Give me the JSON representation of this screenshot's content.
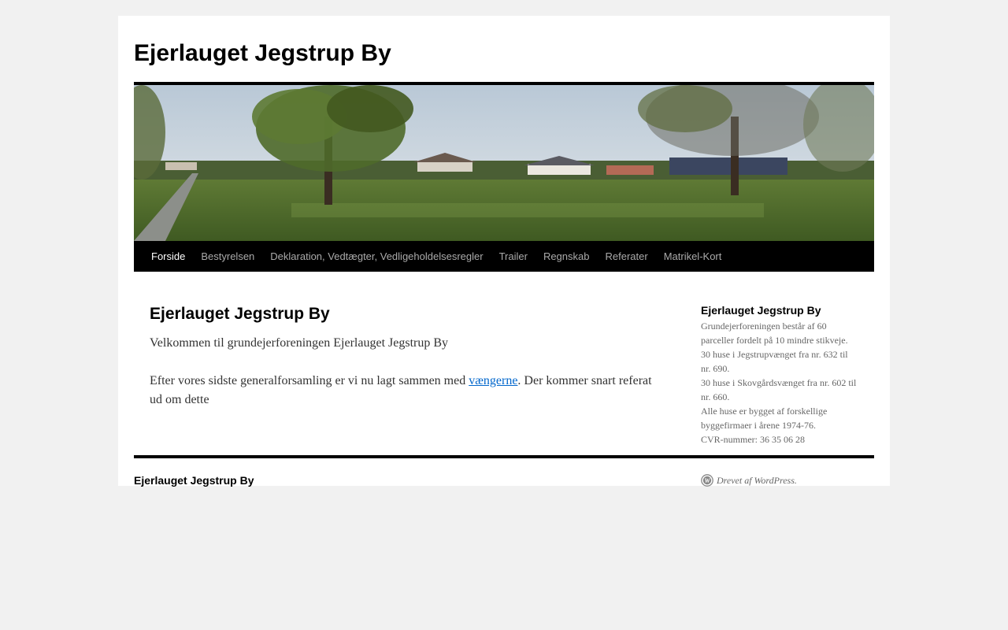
{
  "site": {
    "title": "Ejerlauget Jegstrup By"
  },
  "nav": {
    "items": [
      {
        "label": "Forside"
      },
      {
        "label": "Bestyrelsen"
      },
      {
        "label": "Deklaration, Vedtægter, Vedligeholdelsesregler"
      },
      {
        "label": "Trailer"
      },
      {
        "label": "Regnskab"
      },
      {
        "label": "Referater"
      },
      {
        "label": "Matrikel-Kort"
      }
    ]
  },
  "header_image": {
    "icon": "header-photo"
  },
  "main": {
    "title": "Ejerlauget Jegstrup By",
    "para1": "Velkommen til grundejerforeningen Ejerlauget Jegstrup By",
    "para2_before": "Efter vores sidste generalforsamling er vi nu lagt sammen med ",
    "para2_link": "vængerne",
    "para2_after": ". Der kommer snart referat ud om dette"
  },
  "sidebar": {
    "title": "Ejerlauget Jegstrup By",
    "lines": [
      "Grundejerforeningen består af 60 parceller fordelt på 10 mindre stikveje.",
      "30 huse i Jegstrupvænget fra nr. 632 til nr. 690.",
      "30 huse i Skovgårdsvænget fra nr. 602 til nr. 660.",
      "Alle huse er bygget af forskellige byggefirmaer i årene 1974-76.",
      "CVR-nummer: 36 35 06 28"
    ]
  },
  "footer": {
    "title": "Ejerlauget Jegstrup By",
    "powered": "Drevet af WordPress.",
    "icon": "wordpress-icon"
  },
  "colors": {
    "background": "#f1f1f1",
    "link": "#0066cc",
    "nav_bg": "#000000"
  }
}
